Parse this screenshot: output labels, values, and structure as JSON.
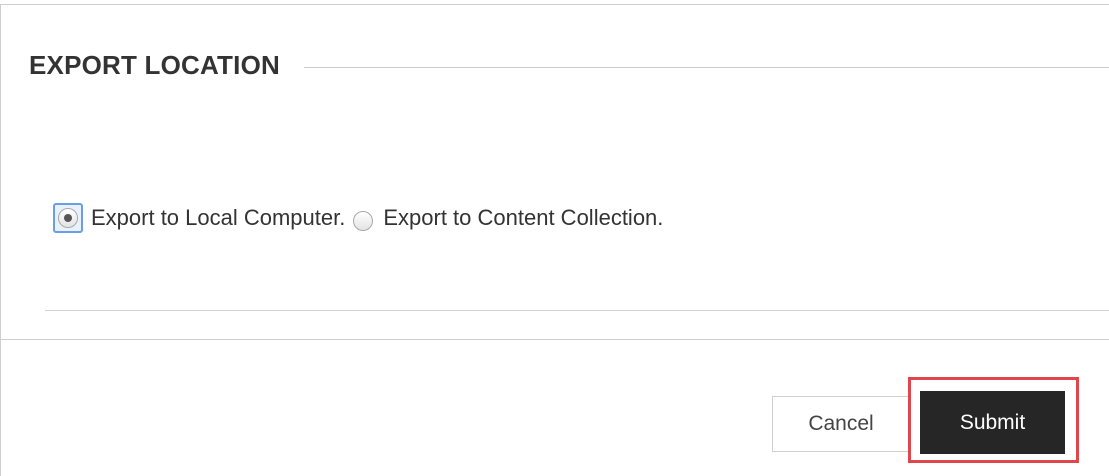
{
  "section": {
    "title": "EXPORT LOCATION"
  },
  "export_options": [
    {
      "label": "Export to Local Computer.",
      "checked": true
    },
    {
      "label": "Export to Content Collection.",
      "checked": false
    }
  ],
  "actions": {
    "cancel_label": "Cancel",
    "submit_label": "Submit",
    "highlight_color": "#e0474c",
    "submit_color": "#262626"
  }
}
